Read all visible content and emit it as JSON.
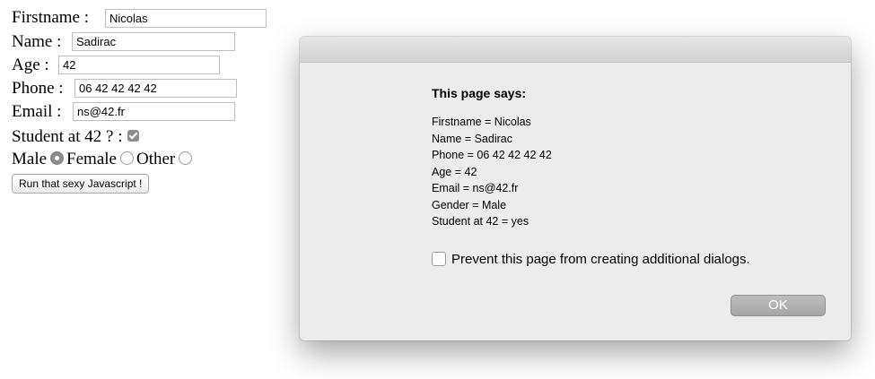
{
  "form": {
    "firstname_label": "Firstname :",
    "firstname_value": "Nicolas",
    "name_label": "Name :",
    "name_value": "Sadirac",
    "age_label": "Age :",
    "age_value": "42",
    "phone_label": "Phone :",
    "phone_value": "06 42 42 42 42",
    "email_label": "Email :",
    "email_value": "ns@42.fr",
    "student_label": "Student at 42 ? :",
    "student_checked": true,
    "gender": {
      "male_label": "Male",
      "female_label": "Female",
      "other_label": "Other",
      "selected": "Male"
    },
    "run_button_label": "Run that sexy Javascript !"
  },
  "dialog": {
    "title": "This page says:",
    "message": "Firstname = Nicolas\nName = Sadirac\nPhone = 06 42 42 42 42\nAge = 42\nEmail = ns@42.fr\nGender = Male\nStudent at 42 = yes",
    "prevent_label": "Prevent this page from creating additional dialogs.",
    "ok_label": "OK"
  },
  "colors": {
    "control_grey": "#8c8c8c",
    "dialog_bg": "#ececec",
    "ok_button": "#b0b0b0"
  }
}
